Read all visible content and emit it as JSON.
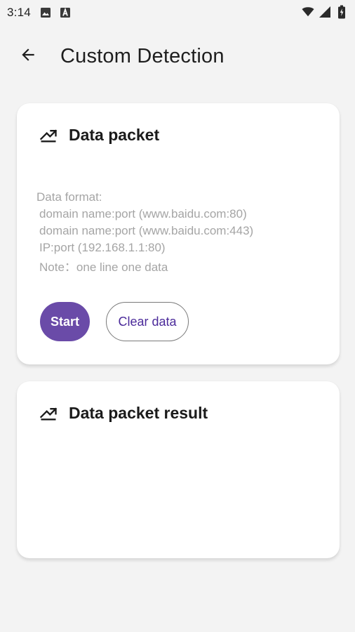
{
  "status_bar": {
    "time": "3:14",
    "left_icons": [
      "image-icon",
      "a-badge-icon"
    ],
    "right_icons": [
      "wifi-icon",
      "signal-icon",
      "battery-icon"
    ]
  },
  "app_bar": {
    "back_icon": "arrow-left-icon",
    "title": "Custom Detection"
  },
  "packet_card": {
    "icon": "trending-down-icon",
    "title": "Data packet",
    "info": {
      "format_label": "Data format:",
      "examples": [
        "domain name:port (www.baidu.com:80)",
        "domain name:port (www.baidu.com:443)",
        "IP:port (192.168.1.1:80)"
      ],
      "note": "Note：one line one data"
    },
    "start_label": "Start",
    "clear_label": "Clear data"
  },
  "result_card": {
    "icon": "trending-down-icon",
    "title": "Data packet result"
  },
  "colors": {
    "background": "#f3f3f3",
    "card": "#ffffff",
    "primary": "#6a4ba8",
    "outline_text": "#4b2a9a",
    "hint_text": "#a5a5a5"
  }
}
